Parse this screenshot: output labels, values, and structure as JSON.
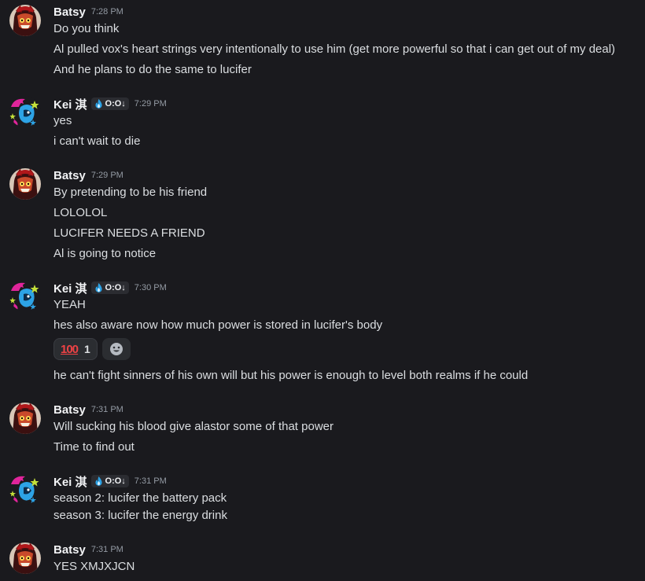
{
  "users": {
    "batsy": {
      "name": "Batsy",
      "avatar_icon": "batsy-avatar-icon"
    },
    "kei": {
      "name": "Kei 淇",
      "tag": "O:O↓",
      "tag_icon": "flame-icon",
      "avatar_icon": "kei-avatar-icon"
    }
  },
  "messages": [
    {
      "author": "Batsy",
      "time": "7:28 PM",
      "lines": [
        "Do you think",
        "Al pulled vox's heart strings very intentionally to use him (get more powerful so that i can get out of my deal)",
        "And he plans to do the same to lucifer"
      ]
    },
    {
      "author": "Kei 淇",
      "tag": "O:O↓",
      "time": "7:29 PM",
      "lines": [
        "yes",
        "i can't wait to die"
      ]
    },
    {
      "author": "Batsy",
      "time": "7:29 PM",
      "lines": [
        "By pretending to be his friend",
        "LOLOLOL",
        "LUCIFER NEEDS A FRIEND",
        "Al is going to notice"
      ]
    },
    {
      "author": "Kei 淇",
      "tag": "O:O↓",
      "time": "7:30 PM",
      "lines": [
        "YEAH",
        "hes also aware now how much power is stored in lucifer's body",
        "he can't fight sinners of his own will but his power is enough to level both realms if he could"
      ],
      "reaction": {
        "emoji": "100",
        "emoji_icon": "hundred-points-icon",
        "count": "1"
      },
      "add_reaction_icon": "add-reaction-icon"
    },
    {
      "author": "Batsy",
      "time": "7:31 PM",
      "lines": [
        "Will sucking his blood give alastor some of that power",
        "Time to find out"
      ]
    },
    {
      "author": "Kei 淇",
      "tag": "O:O↓",
      "time": "7:31 PM",
      "lines": [
        "season 2: lucifer the battery pack",
        "season 3: lucifer the energy drink"
      ]
    },
    {
      "author": "Batsy",
      "time": "7:31 PM",
      "lines": [
        "YES XMJXJCN"
      ]
    }
  ]
}
